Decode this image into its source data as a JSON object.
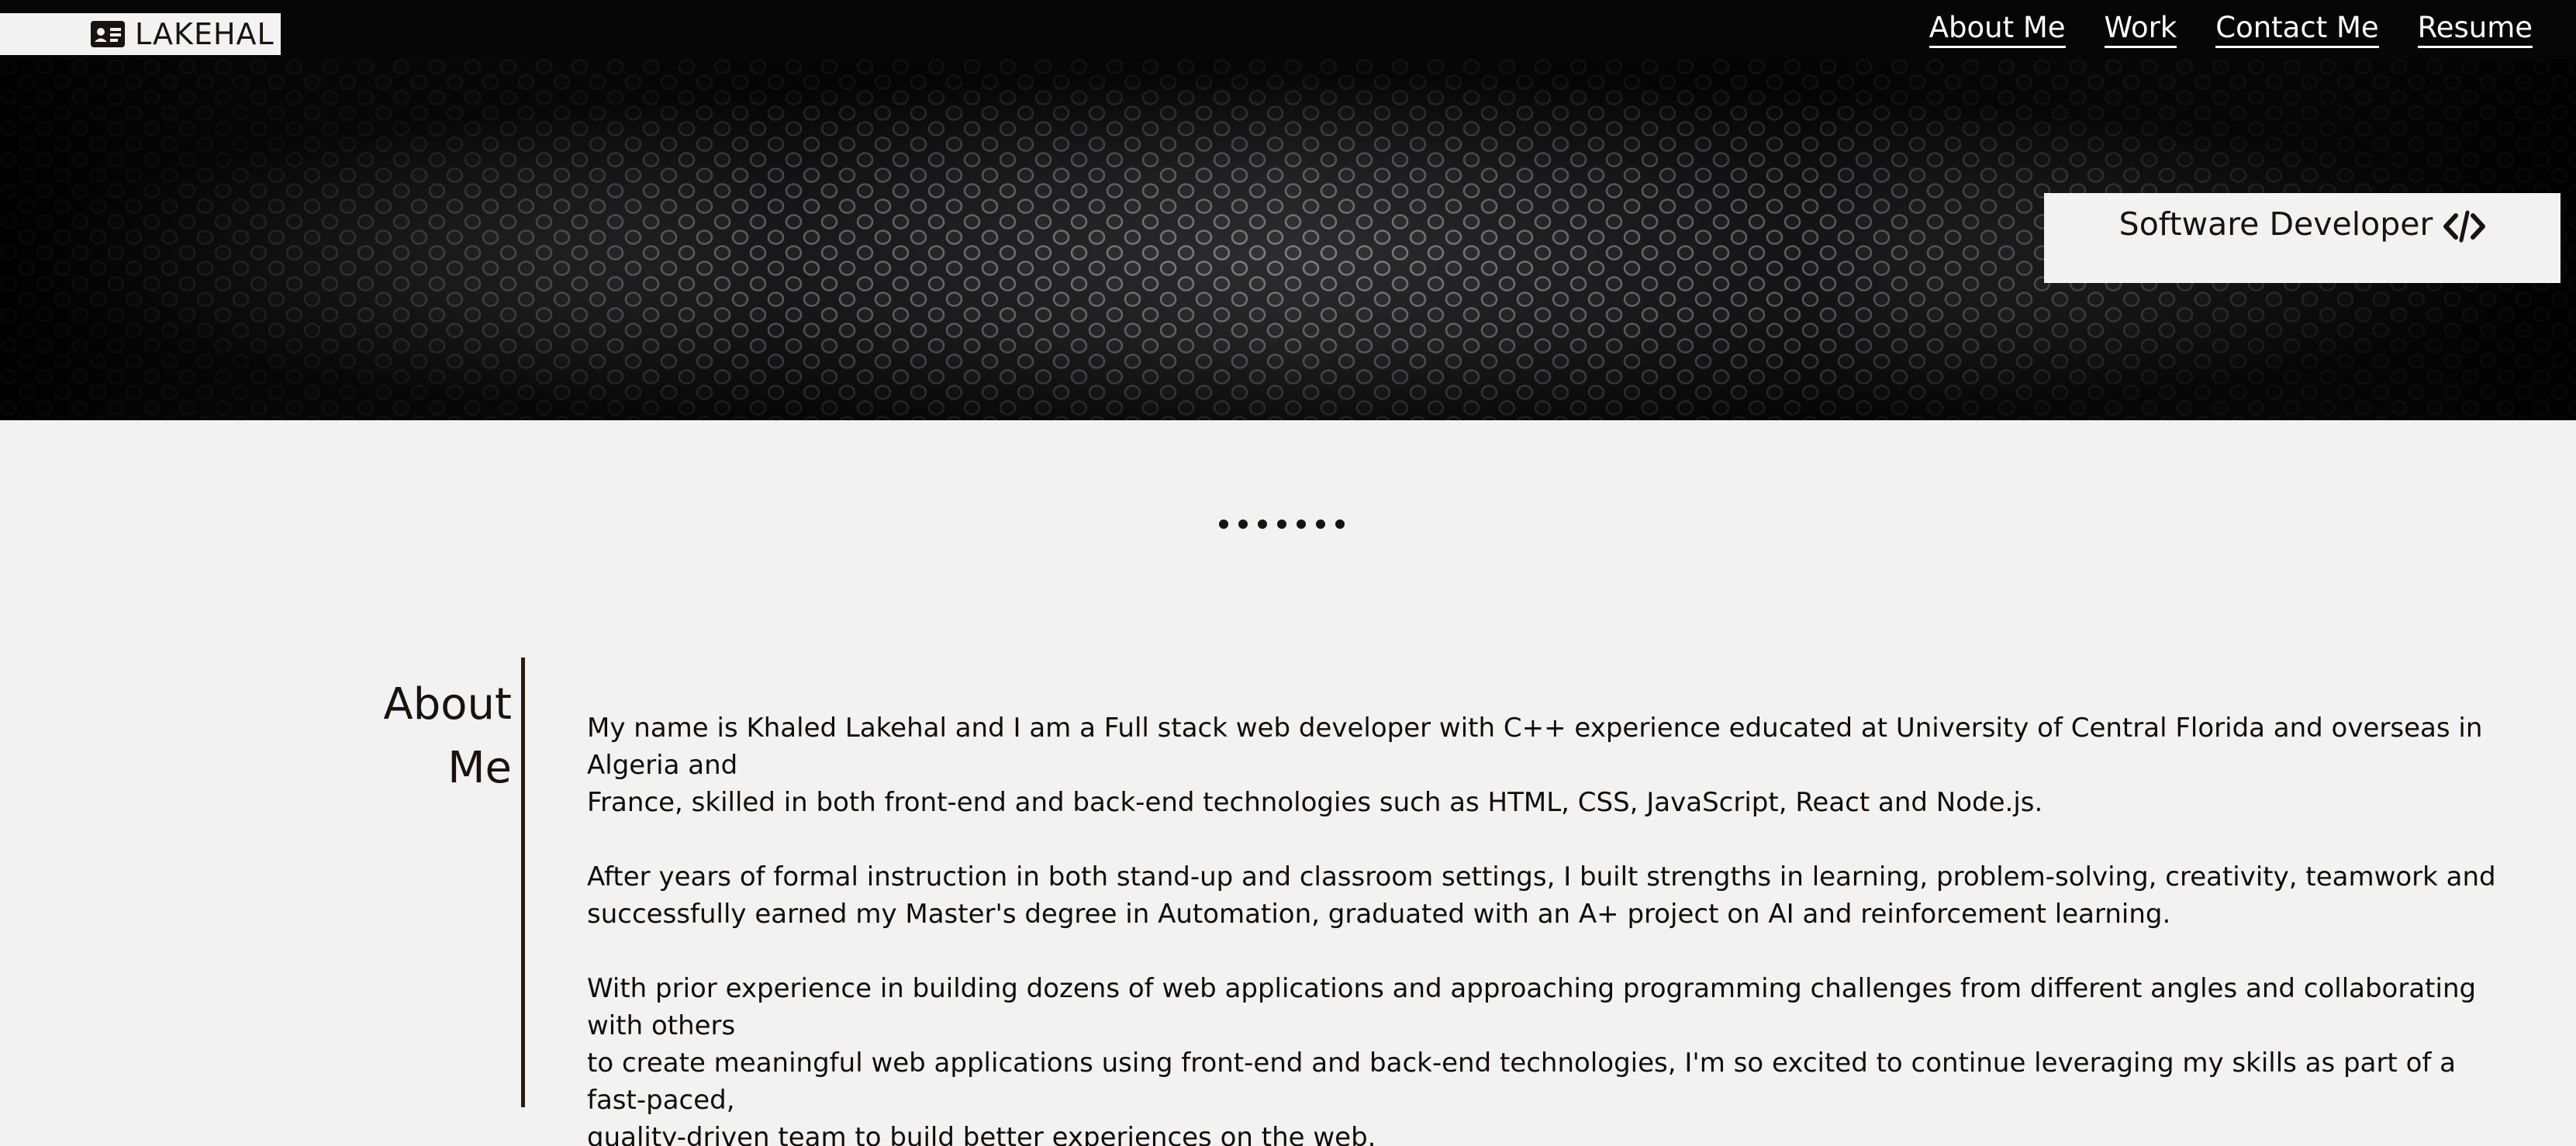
{
  "brand": {
    "icon": "id-card-icon",
    "name": "LAKEHAL"
  },
  "nav": {
    "items": [
      "About Me",
      "Work",
      "Contact Me",
      "Resume"
    ]
  },
  "hero": {
    "background": "hexagon-mesh-texture",
    "tag_text": "Software Developer",
    "tag_icon": "code-icon"
  },
  "about": {
    "heading": "About\nMe",
    "paragraphs": [
      "My name is Khaled Lakehal and I am a Full stack web developer with C++ experience educated at University of Central Florida and overseas in Algeria and\nFrance, skilled in both front-end and back-end technologies such as HTML, CSS, JavaScript, React and Node.js.",
      "After years of formal instruction in both stand-up and classroom settings, I built strengths in learning, problem-solving, creativity, teamwork and\nsuccessfully earned my Master's degree in Automation, graduated with an A+ project on AI and reinforcement learning.",
      "With prior experience in building dozens of web applications and approaching programming challenges from different angles and collaborating with others\nto create meaningful web applications using front-end and back-end technologies, I'm so excited to continue leveraging my skills as part of a fast-paced,\nquality-driven team to build better experiences on the web."
    ]
  },
  "colors": {
    "topbar": "#060606",
    "page_background": "#f2f2f2",
    "text": "#1a120e"
  }
}
